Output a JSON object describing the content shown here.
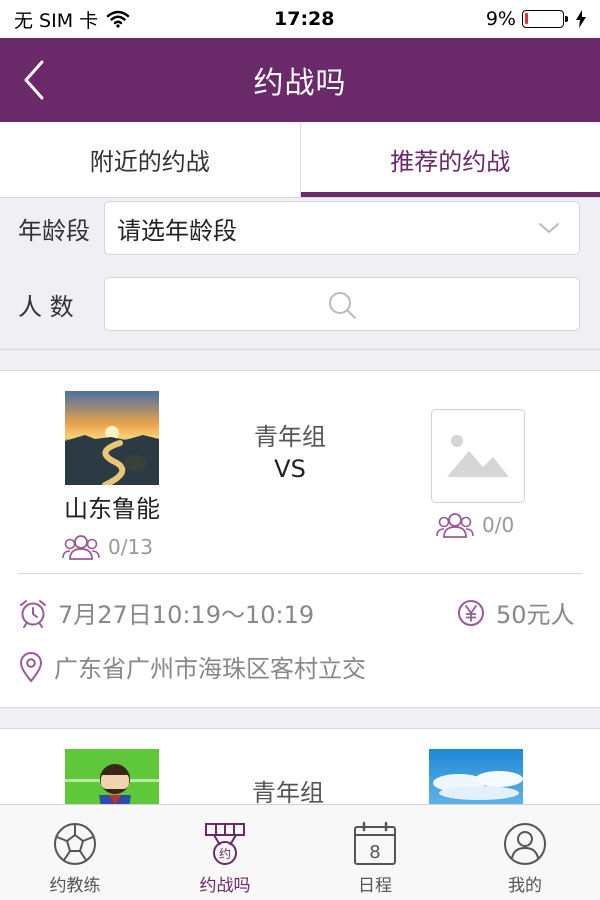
{
  "status_bar": {
    "carrier": "无 SIM 卡",
    "time": "17:28",
    "battery": "9%",
    "battery_level": 0.09
  },
  "nav": {
    "title": "约战吗",
    "back_icon": "chevron-left-icon"
  },
  "tabs": [
    {
      "label": "附近的约战",
      "active": false
    },
    {
      "label": "推荐的约战",
      "active": true
    }
  ],
  "filters": {
    "age": {
      "label": "年龄段",
      "value": "请选年龄段"
    },
    "count": {
      "label": "人 数",
      "value": ""
    }
  },
  "cards": [
    {
      "home": {
        "name": "山东鲁能",
        "members": "0/13",
        "image": "sunset-beach-photo"
      },
      "group": "青年组",
      "vs": "VS",
      "away": {
        "name": "",
        "members": "0/0",
        "image": "image-placeholder-icon"
      },
      "time": "7月27日10:19～10:19",
      "price": "50元人",
      "location": "广东省广州市海珠区客村立交"
    },
    {
      "home": {
        "image": "cartoon-boy-avatar"
      },
      "group": "青年组",
      "away": {
        "image": "sky-clouds-photo"
      }
    }
  ],
  "bottom_tabs": [
    {
      "label": "约教练",
      "icon": "soccer-ball-icon",
      "active": false
    },
    {
      "label": "约战吗",
      "icon": "medal-icon",
      "active": true
    },
    {
      "label": "日程",
      "icon": "calendar-icon",
      "active": false,
      "badge": "8"
    },
    {
      "label": "我的",
      "icon": "profile-icon",
      "active": false
    }
  ],
  "colors": {
    "brand": "#6a2a6a",
    "battery_low": "#e23030"
  }
}
